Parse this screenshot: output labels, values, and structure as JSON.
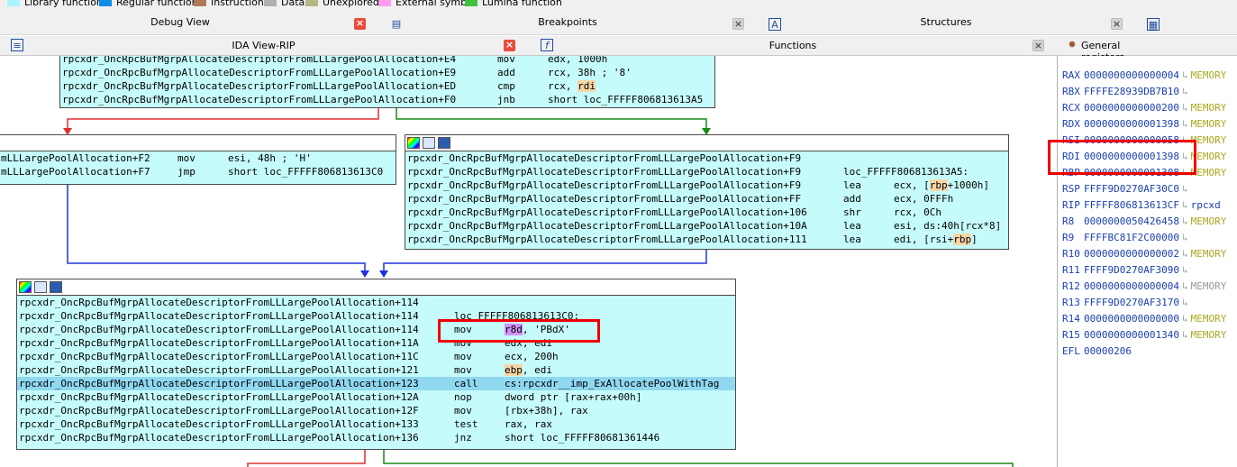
{
  "legend": [
    {
      "label": "Library function",
      "color": "#a8f5ff"
    },
    {
      "label": "Regular function",
      "color": "#0d8ce8"
    },
    {
      "label": "Instruction",
      "color": "#b07a59"
    },
    {
      "label": "Data",
      "color": "#b0b0b0"
    },
    {
      "label": "Unexplored",
      "color": "#b7b784"
    },
    {
      "label": "External symbol",
      "color": "#ff9bf0"
    },
    {
      "label": "Lumina function",
      "color": "#3dc23d"
    }
  ],
  "tabs": {
    "debug_view": "Debug View",
    "breakpoints": "Breakpoints",
    "structures": "Structures",
    "ida_view": "IDA View-RIP",
    "functions": "Functions",
    "general_registers": "General registers"
  },
  "block_top": {
    "rows": [
      {
        "addr": "rpcxdr_OncRpcBufMgrpAllocateDescriptorFromLLLargePoolAllocation+E4",
        "mn": "mov",
        "op": "edx, 1000h"
      },
      {
        "addr": "rpcxdr_OncRpcBufMgrpAllocateDescriptorFromLLLargePoolAllocation+E9",
        "mn": "add",
        "op": "rcx, 38h ; '8'"
      },
      {
        "addr": "rpcxdr_OncRpcBufMgrpAllocateDescriptorFromLLLargePoolAllocation+ED",
        "mn": "cmp",
        "op1": "rcx, ",
        "op2": "rdi"
      },
      {
        "addr": "rpcxdr_OncRpcBufMgrpAllocateDescriptorFromLLLargePoolAllocation+F0",
        "mn": "jnb",
        "op": "short loc_FFFFF806813613A5"
      }
    ]
  },
  "block_left": {
    "rows": [
      {
        "addr": "mLLLargePoolAllocation+F2",
        "mn": "mov",
        "op": "esi, 48h ; 'H'"
      },
      {
        "addr": "mLLLargePoolAllocation+F7",
        "mn": "jmp",
        "op": "short loc_FFFFF806813613C0"
      }
    ]
  },
  "block_right": {
    "rows": [
      {
        "addr": "rpcxdr_OncRpcBufMgrpAllocateDescriptorFromLLLargePoolAllocation+F9",
        "mn": "",
        "op": ""
      },
      {
        "addr": "rpcxdr_OncRpcBufMgrpAllocateDescriptorFromLLLargePoolAllocation+F9",
        "mn": "loc_FFFFF806813613A5:",
        "op": ""
      },
      {
        "addr": "rpcxdr_OncRpcBufMgrpAllocateDescriptorFromLLLargePoolAllocation+F9",
        "mn": "lea",
        "op1": "ecx, [",
        "op2": "rbp",
        "op3": "+1000h]"
      },
      {
        "addr": "rpcxdr_OncRpcBufMgrpAllocateDescriptorFromLLLargePoolAllocation+FF",
        "mn": "add",
        "op": "ecx, 0FFFh"
      },
      {
        "addr": "rpcxdr_OncRpcBufMgrpAllocateDescriptorFromLLLargePoolAllocation+106",
        "mn": "shr",
        "op": "rcx, 0Ch"
      },
      {
        "addr": "rpcxdr_OncRpcBufMgrpAllocateDescriptorFromLLLargePoolAllocation+10A",
        "mn": "lea",
        "op": "esi, ds:40h[rcx*8]"
      },
      {
        "addr": "rpcxdr_OncRpcBufMgrpAllocateDescriptorFromLLLargePoolAllocation+111",
        "mn": "lea",
        "op1": "edi, [rsi+",
        "op2": "rbp",
        "op3": "]"
      }
    ]
  },
  "block_bottom": {
    "rows": [
      {
        "addr": "rpcxdr_OncRpcBufMgrpAllocateDescriptorFromLLLargePoolAllocation+114",
        "mn": "",
        "op": ""
      },
      {
        "addr": "rpcxdr_OncRpcBufMgrpAllocateDescriptorFromLLLargePoolAllocation+114",
        "mn": "loc_FFFFF806813613C0:",
        "op": ""
      },
      {
        "addr": "rpcxdr_OncRpcBufMgrpAllocateDescriptorFromLLLargePoolAllocation+114",
        "mn": "mov",
        "op1": "",
        "op2": "r8d",
        "op3": ", 'PBdX'"
      },
      {
        "addr": "rpcxdr_OncRpcBufMgrpAllocateDescriptorFromLLLargePoolAllocation+11A",
        "mn": "mov",
        "op": "edx, edi"
      },
      {
        "addr": "rpcxdr_OncRpcBufMgrpAllocateDescriptorFromLLLargePoolAllocation+11C",
        "mn": "mov",
        "op": "ecx, 200h"
      },
      {
        "addr": "rpcxdr_OncRpcBufMgrpAllocateDescriptorFromLLLargePoolAllocation+121",
        "mn": "mov",
        "op1": "",
        "op2": "ebp",
        "op3": ", edi"
      },
      {
        "addr": "rpcxdr_OncRpcBufMgrpAllocateDescriptorFromLLLargePoolAllocation+123",
        "mn": "call",
        "op": "cs:rpcxdr__imp_ExAllocatePoolWithTag"
      },
      {
        "addr": "rpcxdr_OncRpcBufMgrpAllocateDescriptorFromLLLargePoolAllocation+12A",
        "mn": "nop",
        "op": "dword ptr [rax+rax+00h]"
      },
      {
        "addr": "rpcxdr_OncRpcBufMgrpAllocateDescriptorFromLLLargePoolAllocation+12F",
        "mn": "mov",
        "op": "[rbx+38h], rax"
      },
      {
        "addr": "rpcxdr_OncRpcBufMgrpAllocateDescriptorFromLLLargePoolAllocation+133",
        "mn": "test",
        "op": "rax, rax"
      },
      {
        "addr": "rpcxdr_OncRpcBufMgrpAllocateDescriptorFromLLLargePoolAllocation+136",
        "mn": "jnz",
        "op": "short loc_FFFFF80681361446"
      }
    ]
  },
  "registers": [
    {
      "name": "RAX",
      "value": "0000000000000004",
      "arrow": "↳",
      "ann": "MEMORY",
      "ann_style": "yellow"
    },
    {
      "name": "RBX",
      "value": "FFFFE28939DB7B10",
      "arrow": "↳",
      "ann": "",
      "ann_style": "yellow"
    },
    {
      "name": "RCX",
      "value": "0000000000000200",
      "arrow": "↳",
      "ann": "MEMORY",
      "ann_style": "yellow"
    },
    {
      "name": "RDX",
      "value": "0000000000001398",
      "arrow": "↳",
      "ann": "MEMORY",
      "ann_style": "yellow"
    },
    {
      "name": "RSI",
      "value": "0000000000000058",
      "arrow": "↳",
      "ann": "MEMORY",
      "ann_style": "yellow"
    },
    {
      "name": "RDI",
      "value": "0000000000001398",
      "arrow": "↳",
      "ann": "MEMORY",
      "ann_style": "yellow"
    },
    {
      "name": "RBP",
      "value": "0000000000001308",
      "arrow": "↳",
      "ann": "MEMORY",
      "ann_style": "yellow"
    },
    {
      "name": "RSP",
      "value": "FFFF9D0270AF30C0",
      "arrow": "↳",
      "ann": "",
      "ann_style": "yellow"
    },
    {
      "name": "RIP",
      "value": "FFFFF806813613CF",
      "arrow": "↳",
      "ann": "rpcxd",
      "ann_style": "blue"
    },
    {
      "name": "R8",
      "value": "0000000050426458",
      "arrow": "↳",
      "ann": "MEMORY",
      "ann_style": "yellow"
    },
    {
      "name": "R9",
      "value": "FFFFBC81F2C00000",
      "arrow": "↳",
      "ann": "",
      "ann_style": "yellow"
    },
    {
      "name": "R10",
      "value": "0000000000000002",
      "arrow": "↳",
      "ann": "MEMORY",
      "ann_style": "yellow"
    },
    {
      "name": "R11",
      "value": "FFFF9D0270AF3090",
      "arrow": "↳",
      "ann": "",
      "ann_style": "yellow"
    },
    {
      "name": "R12",
      "value": "0000000000000004",
      "arrow": "↳",
      "ann": "MEMORY",
      "ann_style": "grey"
    },
    {
      "name": "R13",
      "value": "FFFF9D0270AF3170",
      "arrow": "↳",
      "ann": "",
      "ann_style": "yellow"
    },
    {
      "name": "R14",
      "value": "0000000000000000",
      "arrow": "↳",
      "ann": "MEMORY",
      "ann_style": "yellow"
    },
    {
      "name": "R15",
      "value": "0000000000001340",
      "arrow": "↳",
      "ann": "MEMORY",
      "ann_style": "yellow"
    },
    {
      "name": "EFL",
      "value": "00000206",
      "arrow": "",
      "ann": "",
      "ann_style": "yellow"
    }
  ],
  "colors": {
    "node_bg": "#c6fbfb",
    "edge_red": "#e03030",
    "edge_green": "#1a8a1a",
    "edge_blue": "#2030e0",
    "annotation_box": "#ee0000"
  }
}
